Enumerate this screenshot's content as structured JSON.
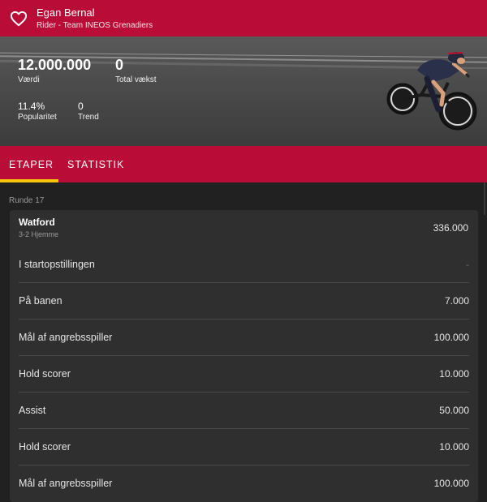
{
  "header": {
    "title": "Egan Bernal",
    "subtitle": "Rider - Team INEOS Grenadiers",
    "favorite_icon": "heart-outline-icon"
  },
  "stats": {
    "value": {
      "number": "12.000.000",
      "label": "Værdi"
    },
    "growth": {
      "number": "0",
      "label": "Total vækst"
    },
    "popularity": {
      "number": "11.4%",
      "label": "Popularitet"
    },
    "trend": {
      "number": "0",
      "label": "Trend"
    }
  },
  "tabs": [
    {
      "label": "ETAPER",
      "active": true
    },
    {
      "label": "STATISTIK",
      "active": false
    }
  ],
  "colors": {
    "brand": "#b90c37",
    "accent": "#f6c50e",
    "background": "#212121",
    "card": "#2f2f2f"
  },
  "round_label": "Runde 17",
  "match": {
    "name": "Watford",
    "detail": "3-2 Hjemme",
    "value": "336.000"
  },
  "rows": [
    {
      "label": "I startopstillingen",
      "value": "-"
    },
    {
      "label": "På banen",
      "value": "7.000"
    },
    {
      "label": "Mål af angrebsspiller",
      "value": "100.000"
    },
    {
      "label": "Hold scorer",
      "value": "10.000"
    },
    {
      "label": "Assist",
      "value": "50.000"
    },
    {
      "label": "Hold scorer",
      "value": "10.000"
    },
    {
      "label": "Mål af angrebsspiller",
      "value": "100.000"
    }
  ]
}
